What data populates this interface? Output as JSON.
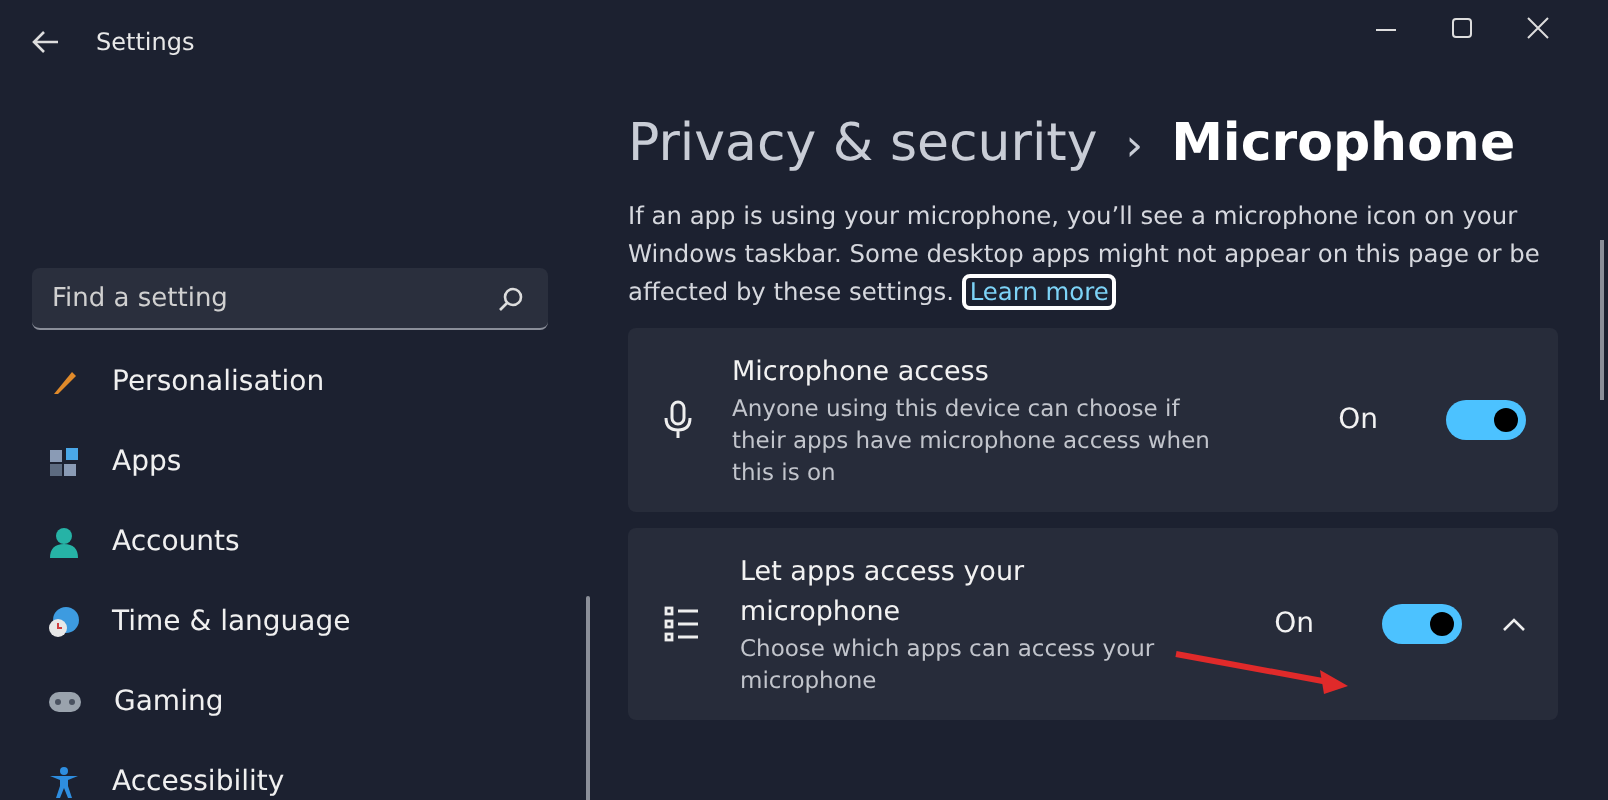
{
  "window": {
    "title": "Settings"
  },
  "search": {
    "placeholder": "Find a setting"
  },
  "nav": [
    {
      "label": "Personalisation",
      "selected": false
    },
    {
      "label": "Apps",
      "selected": false
    },
    {
      "label": "Accounts",
      "selected": false
    },
    {
      "label": "Time & language",
      "selected": false
    },
    {
      "label": "Gaming",
      "selected": false
    },
    {
      "label": "Accessibility",
      "selected": false
    }
  ],
  "breadcrumb": {
    "parent": "Privacy & security",
    "separator": "›",
    "current": "Microphone"
  },
  "description": {
    "text": "If an app is using your microphone, you’ll see a microphone icon on your Windows taskbar. Some desktop apps might not appear on this page or be affected by these settings.",
    "link": "Learn more"
  },
  "cards": [
    {
      "title": "Microphone access",
      "subtitle": "Anyone using this device can choose if their apps have microphone access when this is on",
      "state_label": "On",
      "on": true
    },
    {
      "title": "Let apps access your microphone",
      "subtitle": "Choose which apps can access your microphone",
      "state_label": "On",
      "on": true,
      "expanded": true
    }
  ]
}
